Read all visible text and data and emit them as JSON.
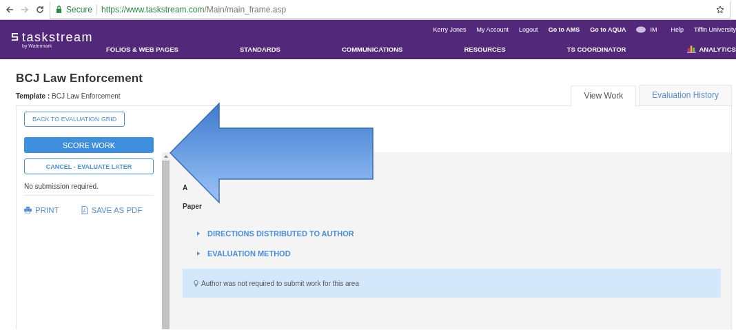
{
  "browser": {
    "security": "Secure",
    "url_host": "https://www.taskstream.com",
    "url_path": "/Main/main_frame.asp"
  },
  "header": {
    "logo": "taskstream",
    "logo_sub": "by Watermark",
    "user_links": [
      {
        "label": "Kerry Jones",
        "bold": false,
        "kind": "link"
      },
      {
        "label": "My Account",
        "bold": false,
        "kind": "link"
      },
      {
        "label": "Logout",
        "bold": false,
        "kind": "link"
      },
      {
        "label": "Go to AMS",
        "bold": true,
        "kind": "link"
      },
      {
        "label": "Go to AQUA",
        "bold": true,
        "kind": "link"
      },
      {
        "label": "IM",
        "bold": false,
        "kind": "chat"
      },
      {
        "label": "Help",
        "bold": false,
        "kind": "link"
      },
      {
        "label": "Tiffin University",
        "bold": false,
        "kind": "link"
      }
    ],
    "nav": [
      {
        "label": "FOLIOS & WEB PAGES",
        "kind": "link"
      },
      {
        "label": "STANDARDS",
        "kind": "link"
      },
      {
        "label": "COMMUNICATIONS",
        "kind": "link"
      },
      {
        "label": "RESOURCES",
        "kind": "link"
      },
      {
        "label": "TS COORDINATOR",
        "kind": "link"
      },
      {
        "label": "ANALYTICS",
        "kind": "analytics"
      }
    ]
  },
  "page": {
    "title": "BCJ Law Enforcement",
    "template_label": "Template :",
    "template_value": "BCJ Law Enforcement"
  },
  "tabs": [
    {
      "label": "View Work",
      "selected": true
    },
    {
      "label": "Evaluation History",
      "selected": false
    }
  ],
  "sidebar": {
    "back_button": "BACK TO EVALUATION GRID",
    "score_button": "SCORE WORK",
    "cancel_button": "CANCEL - EVALUATE LATER",
    "note": "No submission required.",
    "print": "PRINT",
    "save_pdf": "SAVE AS PDF"
  },
  "content": {
    "partial_lines": [
      "A",
      "Paper"
    ],
    "sections": [
      {
        "label": "DIRECTIONS DISTRIBUTED TO AUTHOR",
        "expanded": false
      },
      {
        "label": "EVALUATION METHOD",
        "expanded": false
      }
    ],
    "info": "Author was not required to submit work for this area"
  }
}
